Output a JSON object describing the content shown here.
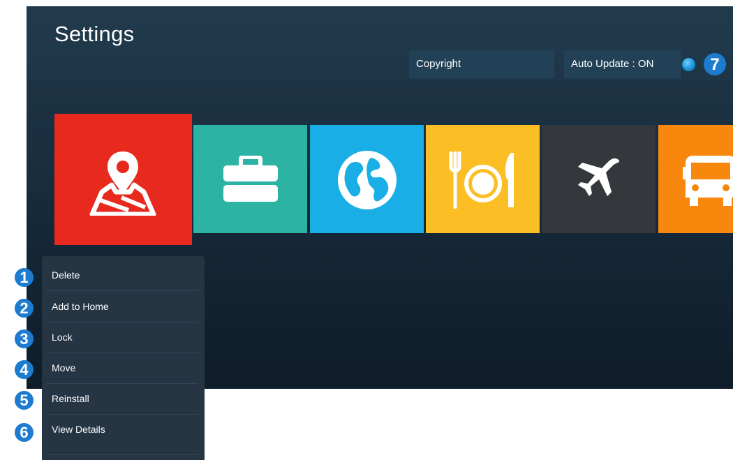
{
  "screen": {
    "title": "Settings",
    "copyright_label": "Copyright",
    "auto_update_label": "Auto Update : ON"
  },
  "tiles": [
    {
      "name": "map-location-app",
      "icon": "map-pin-icon",
      "color": "#e8291d",
      "focused": true
    },
    {
      "name": "briefcase-app",
      "icon": "briefcase-icon",
      "color": "#2db3a4"
    },
    {
      "name": "globe-app",
      "icon": "globe-icon",
      "color": "#19aee6"
    },
    {
      "name": "dining-app",
      "icon": "dining-icon",
      "color": "#fbbe24"
    },
    {
      "name": "flight-app",
      "icon": "airplane-icon",
      "color": "#34383c"
    },
    {
      "name": "bus-app",
      "icon": "bus-icon",
      "color": "#f8870d"
    }
  ],
  "menu": {
    "items": [
      "Delete",
      "Add to Home",
      "Lock",
      "Move",
      "Reinstall",
      "View Details"
    ]
  },
  "callouts": [
    "1",
    "2",
    "3",
    "4",
    "5",
    "6",
    "7"
  ],
  "colors": {
    "accent": "#1d7ccf",
    "panel": "#253544",
    "background": "#1a3041"
  }
}
